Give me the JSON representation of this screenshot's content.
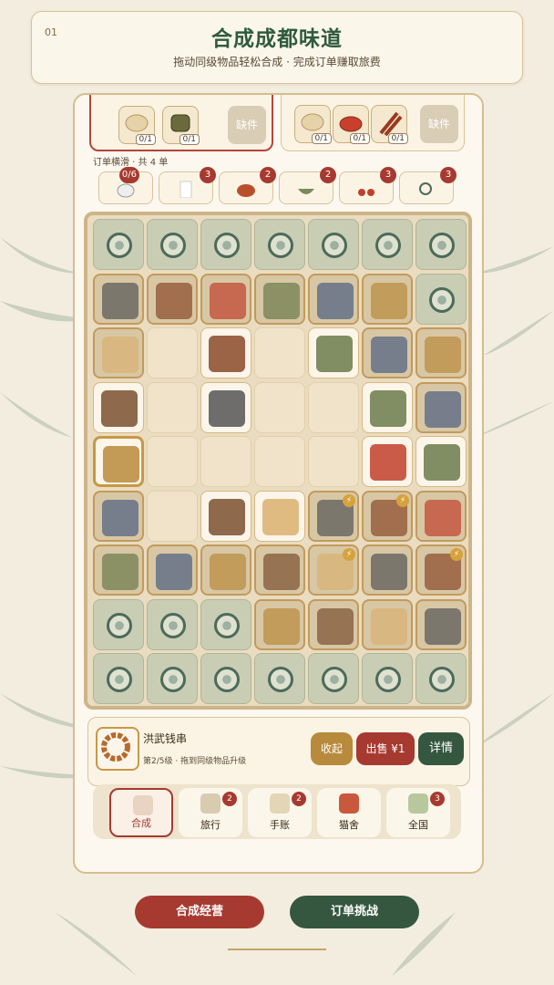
{
  "header": {
    "step": "01",
    "title": "合成成都味道",
    "subtitle": "拖动同级物品轻松合成 · 完成订单赚取旅费"
  },
  "orders": {
    "hint": "订单横滑 · 共 4 单",
    "cards": [
      {
        "requirements": [
          {
            "qty": "0/1"
          },
          {
            "qty": "0/1"
          }
        ],
        "missing_label": "缺件"
      },
      {
        "requirements": [
          {
            "qty": "0/1"
          },
          {
            "qty": "0/1"
          },
          {
            "qty": "0/1"
          }
        ],
        "missing_label": "缺件"
      }
    ],
    "tabs": [
      {
        "badge": "0/6"
      },
      {
        "badge": "3"
      },
      {
        "badge": "2"
      },
      {
        "badge": "2"
      },
      {
        "badge": "3"
      },
      {
        "badge": "3"
      }
    ]
  },
  "board": {
    "rows": [
      [
        "locked",
        "locked",
        "locked",
        "locked",
        "locked",
        "locked",
        "locked"
      ],
      [
        "web",
        "web",
        "web",
        "web",
        "web",
        "web",
        "locked"
      ],
      [
        "web",
        "empty",
        "item",
        "empty",
        "item",
        "web",
        "web"
      ],
      [
        "item",
        "empty",
        "item",
        "empty",
        "empty",
        "item",
        "web"
      ],
      [
        "item-sel",
        "empty",
        "empty",
        "empty",
        "empty",
        "item",
        "item"
      ],
      [
        "web",
        "empty",
        "item",
        "item",
        "web-bolt",
        "web-bolt",
        "web"
      ],
      [
        "web",
        "web",
        "web",
        "web",
        "web-bolt",
        "web",
        "web-bolt"
      ],
      [
        "locked",
        "locked",
        "locked",
        "web",
        "web",
        "web",
        "web"
      ],
      [
        "locked",
        "locked",
        "locked",
        "locked",
        "locked",
        "locked",
        "locked"
      ]
    ]
  },
  "selected_item": {
    "name": "洪武钱串",
    "desc": "第2/5级 · 拖到同级物品升级",
    "collect_label": "收起",
    "sell_label": "出售 ¥1",
    "detail_label": "详情"
  },
  "nav": [
    {
      "label": "合成",
      "icon": "merge-icon",
      "badge": ""
    },
    {
      "label": "旅行",
      "icon": "travel-icon",
      "badge": "2"
    },
    {
      "label": "手账",
      "icon": "journal-icon",
      "badge": "2"
    },
    {
      "label": "猫舍",
      "icon": "cat-house-icon",
      "badge": ""
    },
    {
      "label": "全国",
      "icon": "map-icon",
      "badge": "3"
    }
  ],
  "buttons": {
    "merge": "合成经营",
    "orders": "订单挑战"
  },
  "colors": {
    "accent_red": "#a63a30",
    "accent_green": "#35573f",
    "gold": "#c89845"
  }
}
